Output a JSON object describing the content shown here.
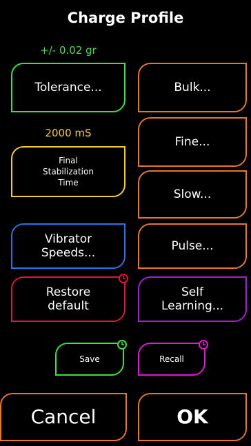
{
  "header": {
    "title": "Charge Profile"
  },
  "tolerance": {
    "value": "+/- 0.02 gr",
    "label": "Tolerance..."
  },
  "stabilization": {
    "value": "2000 mS",
    "label": "Final\nStabilization\nTime"
  },
  "vibrator": {
    "label": "Vibrator\nSpeeds..."
  },
  "restore": {
    "label": "Restore\ndefault"
  },
  "bulk": {
    "label": "Bulk..."
  },
  "fine": {
    "label": "Fine..."
  },
  "slow": {
    "label": "Slow..."
  },
  "pulse": {
    "label": "Pulse..."
  },
  "self_learning": {
    "label": "Self\nLearning..."
  },
  "save": {
    "label": "Save"
  },
  "recall": {
    "label": "Recall"
  },
  "footer": {
    "cancel": "Cancel",
    "ok": "OK"
  },
  "colors": {
    "green": "#3ee23e",
    "yellow": "#f0d020",
    "orange": "#e87722",
    "blue": "#2476e8",
    "red": "#e0123e",
    "purple": "#a21ed8",
    "magenta": "#e018d8"
  },
  "icons": {
    "clock": "clock-icon"
  }
}
